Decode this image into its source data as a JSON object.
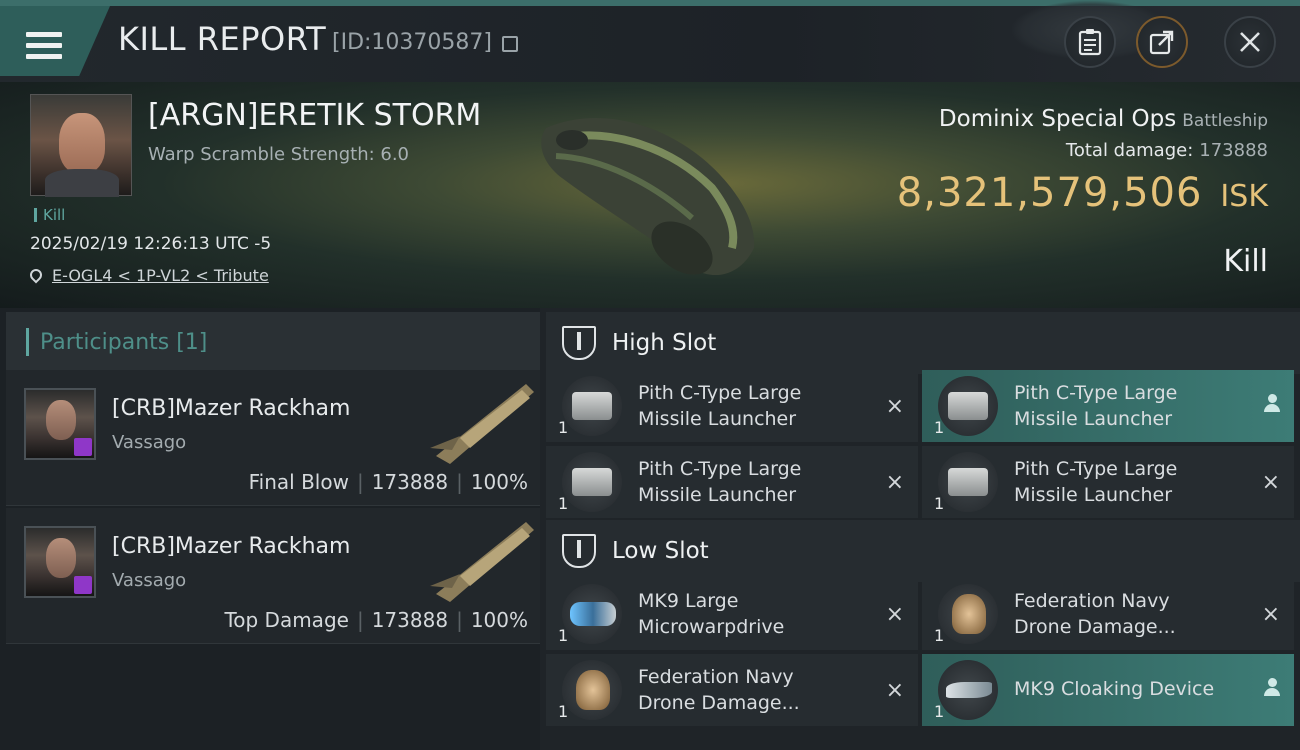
{
  "header": {
    "title": "KILL REPORT",
    "report_id": "[ID:10370587]"
  },
  "victim": {
    "name": "[ARGN]ERETIK STORM",
    "warp_scramble": "Warp Scramble Strength: 6.0",
    "tag": "Kill",
    "time": "2025/02/19 12:26:13 UTC -5",
    "location": "E-OGL4 < 1P-VL2 < Tribute",
    "ship": "Dominix Special Ops",
    "ship_class": "Battleship",
    "total_damage_label": "Total damage:",
    "total_damage": "173888",
    "isk_value": "8,321,579,506",
    "isk_unit": "ISK",
    "result": "Kill"
  },
  "participants": {
    "title": "Participants [1]",
    "rows": [
      {
        "name": "[CRB]Mazer Rackham",
        "corp": "Vassago",
        "role": "Final Blow",
        "damage": "173888",
        "percent": "100%"
      },
      {
        "name": "[CRB]Mazer Rackham",
        "corp": "Vassago",
        "role": "Top Damage",
        "damage": "173888",
        "percent": "100%"
      }
    ]
  },
  "fitting": {
    "high_slot": {
      "label": "High Slot",
      "modules": [
        {
          "line1": "Pith C-Type Large",
          "line2": "Missile Launcher",
          "qty": "1",
          "status": "×"
        },
        {
          "line1": "Pith C-Type Large",
          "line2": "Missile Launcher",
          "qty": "1",
          "status": "person"
        },
        {
          "line1": "Pith C-Type Large",
          "line2": "Missile Launcher",
          "qty": "1",
          "status": "×"
        },
        {
          "line1": "Pith C-Type Large",
          "line2": "Missile Launcher",
          "qty": "1",
          "status": "×"
        }
      ]
    },
    "low_slot": {
      "label": "Low Slot",
      "modules": [
        {
          "line1": "MK9 Large",
          "line2": "Microwarpdrive",
          "qty": "1",
          "status": "×"
        },
        {
          "line1": "Federation Navy",
          "line2": "Drone Damage...",
          "qty": "1",
          "status": "×"
        },
        {
          "line1": "Federation Navy",
          "line2": "Drone Damage...",
          "qty": "1",
          "status": "×"
        },
        {
          "line1": "MK9 Cloaking Device",
          "line2": "",
          "qty": "1",
          "status": "person"
        }
      ]
    }
  },
  "colors": {
    "accent": "#3c6e6a",
    "isk": "#e5c27a",
    "active_module": "#3d7c76"
  }
}
